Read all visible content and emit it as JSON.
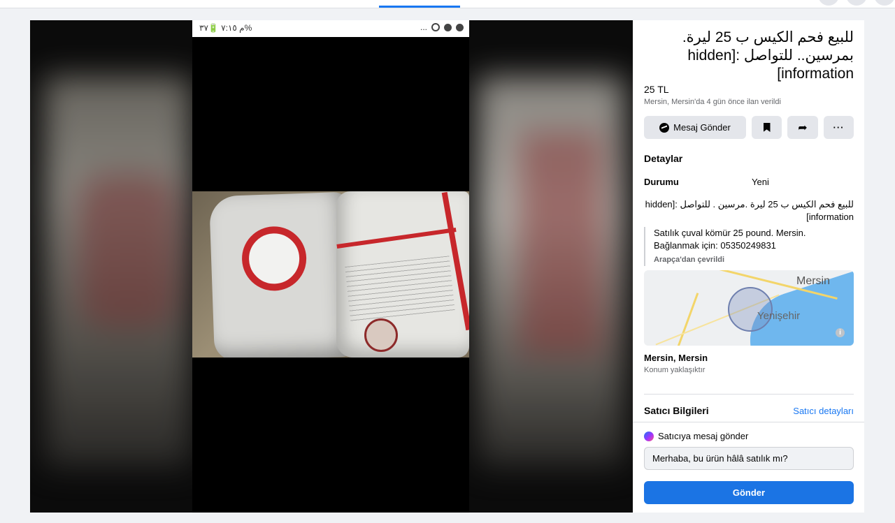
{
  "status_bar": {
    "time_battery": "م ٧:١٥ 🔋٣٧%",
    "right_text": "..."
  },
  "listing": {
    "title": "للبيع فحم الكيس ب 25 ليرة. بمرسين.. للتواصل :[hidden information]",
    "price": "25 TL",
    "meta": "Mersin, Mersin'da 4 gün önce ilan verildi"
  },
  "actions": {
    "message_label": "Mesaj Gönder",
    "more_label": "···"
  },
  "details": {
    "heading": "Detaylar",
    "condition_key": "Durumu",
    "condition_value": "Yeni",
    "description_ar": "للبيع فحم الكيس ب 25 ليرة .مرسين . للتواصل :[hidden information]",
    "translation_line1": "Satılık çuval kömür 25 pound. Mersin.",
    "translation_line2": "Bağlanmak için: 05350249831",
    "translation_note": "Arapça'dan çevrildi"
  },
  "map": {
    "city_label": "Mersin",
    "district_label": "Yenişehir",
    "info_glyph": "i"
  },
  "location": {
    "name": "Mersin, Mersin",
    "note": "Konum yaklaşıktır"
  },
  "seller": {
    "heading": "Satıcı Bilgileri",
    "details_link": "Satıcı detayları"
  },
  "contact": {
    "heading": "Satıcıya mesaj gönder",
    "message_value": "Merhaba, bu ürün hâlâ satılık mı?",
    "send_label": "Gönder"
  },
  "colors": {
    "accent": "#1877f2",
    "send_button": "#1b74e4",
    "page_bg": "#f0f2f5"
  },
  "icons": [
    "messenger-icon",
    "bookmark-icon",
    "share-icon",
    "more-icon",
    "info-icon"
  ]
}
